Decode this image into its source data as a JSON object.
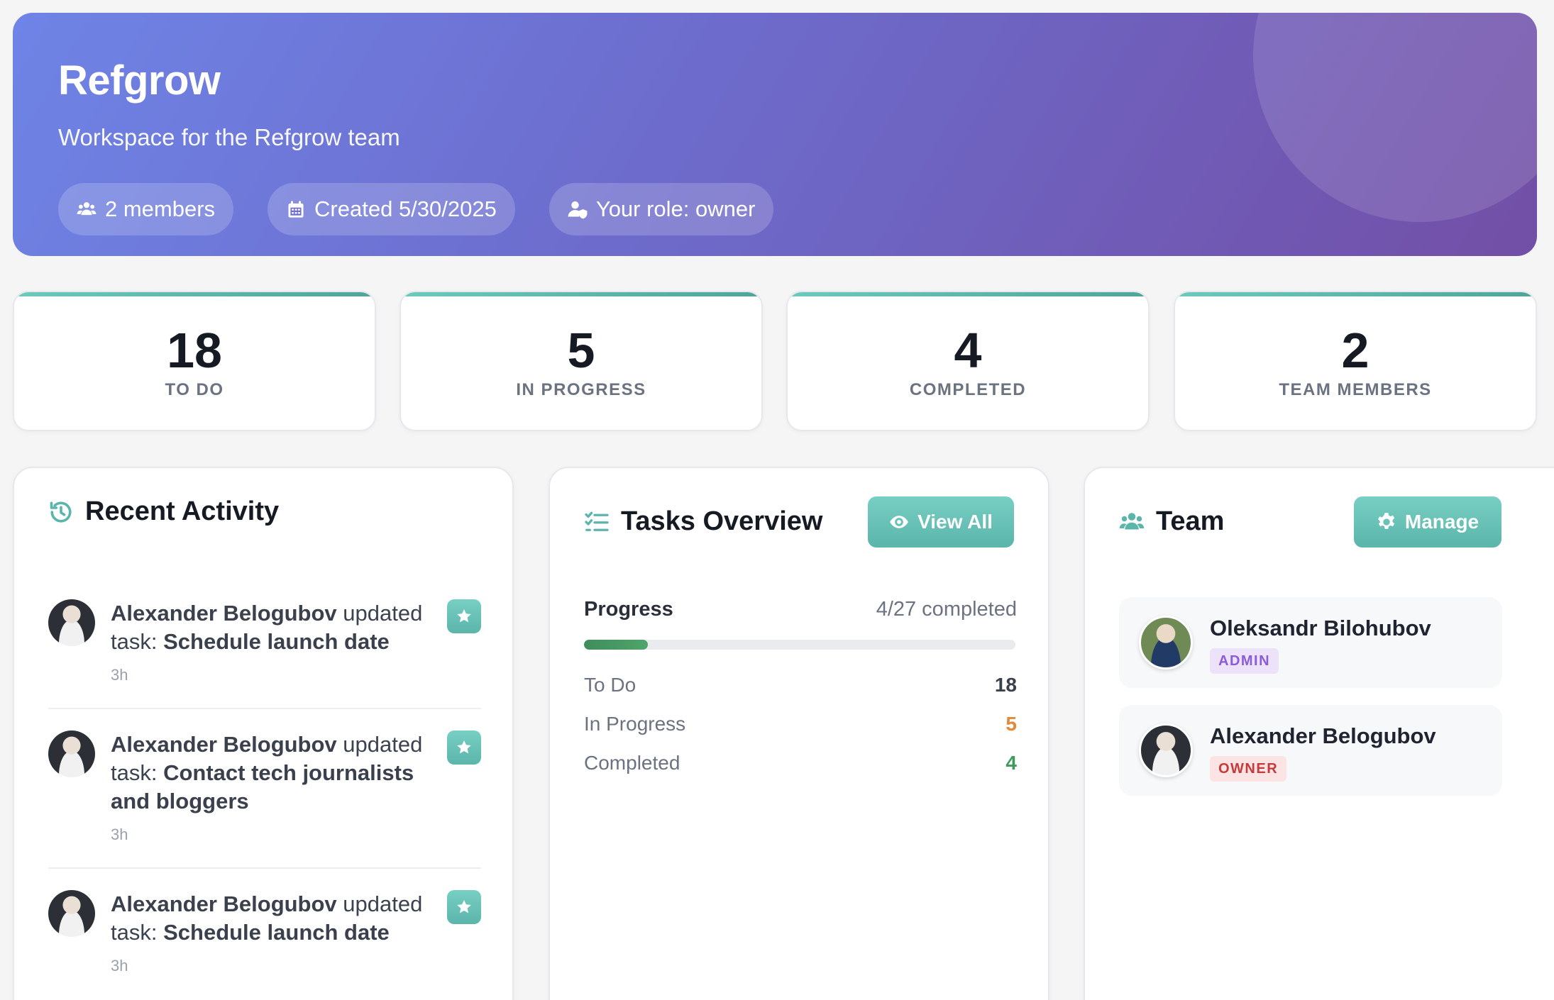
{
  "colors": {
    "accent": "#5bb5aa",
    "hero_start": "#6e84e6",
    "hero_end": "#724fa6",
    "in_progress": "#e08a3c",
    "completed": "#3f9a5d",
    "admin_badge_bg": "#ece3fb",
    "admin_badge_text": "#8b5cd6",
    "owner_badge_bg": "#fde4e4",
    "owner_badge_text": "#c53b3b"
  },
  "hero": {
    "title": "Refgrow",
    "subtitle": "Workspace for the Refgrow team",
    "pills": [
      {
        "icon": "users-icon",
        "text": "2 members"
      },
      {
        "icon": "calendar-icon",
        "text": "Created 5/30/2025"
      },
      {
        "icon": "user-shield-icon",
        "text": "Your role: owner"
      }
    ]
  },
  "stats": [
    {
      "value": "18",
      "label": "TO DO"
    },
    {
      "value": "5",
      "label": "IN PROGRESS"
    },
    {
      "value": "4",
      "label": "COMPLETED"
    },
    {
      "value": "2",
      "label": "TEAM MEMBERS"
    }
  ],
  "activity": {
    "title": "Recent Activity",
    "icon": "history-icon",
    "items": [
      {
        "user": "Alexander Belogubov",
        "action": " updated task: ",
        "task": "Schedule launch date",
        "time": "3h",
        "badge_icon": "star-icon"
      },
      {
        "user": "Alexander Belogubov",
        "action": " updated task: ",
        "task": "Contact tech journalists and bloggers",
        "time": "3h",
        "badge_icon": "star-icon"
      },
      {
        "user": "Alexander Belogubov",
        "action": " updated task: ",
        "task": "Schedule launch date",
        "time": "3h",
        "badge_icon": "star-icon"
      }
    ]
  },
  "tasks": {
    "title": "Tasks Overview",
    "icon": "list-check-icon",
    "view_all_label": "View All",
    "progress_label": "Progress",
    "progress_count": "4/27 completed",
    "progress_fraction": 0.148,
    "rows": [
      {
        "label": "To Do",
        "value": "18"
      },
      {
        "label": "In Progress",
        "value": "5"
      },
      {
        "label": "Completed",
        "value": "4"
      }
    ]
  },
  "team": {
    "title": "Team",
    "icon": "users-icon",
    "manage_label": "Manage",
    "members": [
      {
        "name": "Oleksandr Bilohubov",
        "role": "ADMIN"
      },
      {
        "name": "Alexander Belogubov",
        "role": "OWNER"
      }
    ]
  }
}
